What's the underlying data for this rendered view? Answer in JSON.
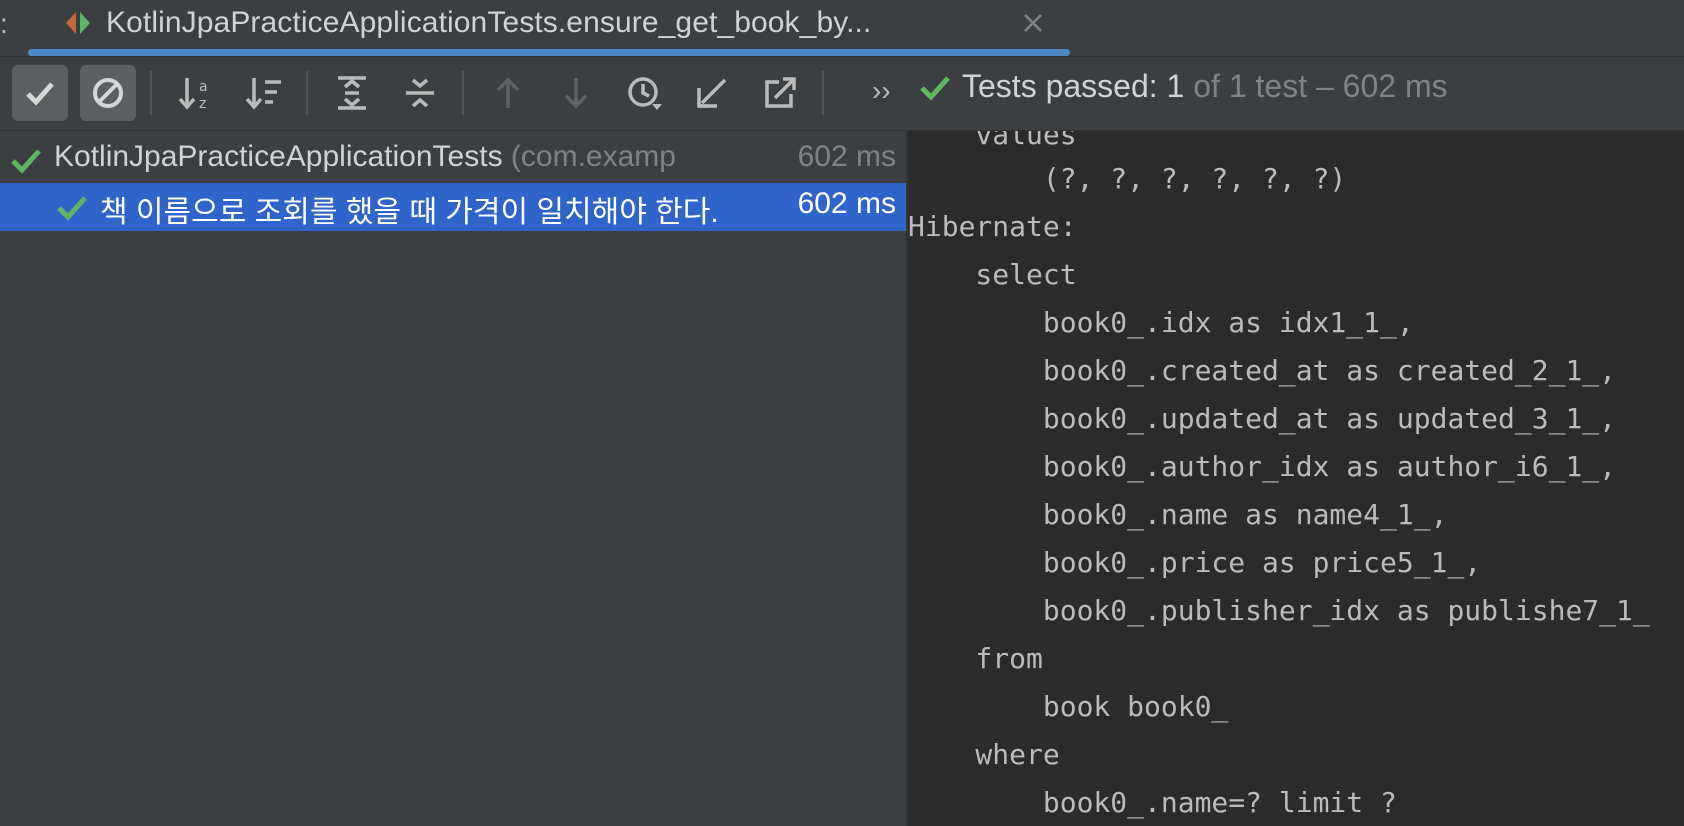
{
  "tab": {
    "prefix": ":",
    "title": "KotlinJpaPracticeApplicationTests.ensure_get_book_by...",
    "icon": "run-test-icon",
    "close_icon": "close-icon"
  },
  "toolbar": {
    "buttons": [
      {
        "name": "show-passed-button",
        "icon": "check-icon",
        "active": true
      },
      {
        "name": "show-ignored-button",
        "icon": "ignored-icon",
        "active": true
      },
      {
        "name": "sort-alphabetically-button",
        "icon": "sort-az-icon"
      },
      {
        "name": "sort-by-duration-button",
        "icon": "sort-duration-icon"
      },
      {
        "name": "expand-all-button",
        "icon": "expand-all-icon"
      },
      {
        "name": "collapse-all-button",
        "icon": "collapse-all-icon"
      },
      {
        "name": "previous-failed-button",
        "icon": "arrow-up-icon"
      },
      {
        "name": "next-failed-button",
        "icon": "arrow-down-icon"
      },
      {
        "name": "test-history-button",
        "icon": "history-icon"
      },
      {
        "name": "import-tests-button",
        "icon": "import-icon"
      },
      {
        "name": "export-tests-button",
        "icon": "export-icon"
      }
    ],
    "overflow_label": "››",
    "status": {
      "main": "Tests passed: 1",
      "muted": " of 1 test – 602 ms"
    }
  },
  "tree": {
    "root": {
      "name": "KotlinJpaPracticeApplicationTests",
      "package": " (com.examp",
      "time": "602 ms"
    },
    "child": {
      "name": "책 이름으로 조회를 했을 때 가격이 일치해야 한다.",
      "time": "602 ms"
    }
  },
  "console": {
    "lines": [
      {
        "text": "    values"
      },
      {
        "text": "        (?, ?, ?, ?, ?, ?)"
      },
      {
        "text": "Hibernate: "
      },
      {
        "text": "    select"
      },
      {
        "text": "        book0_.idx as idx1_1_,"
      },
      {
        "text": "        book0_.created_at as created_2_1_,"
      },
      {
        "text": "        book0_.updated_at as updated_3_1_,"
      },
      {
        "text": "        book0_.author_idx as author_i6_1_,"
      },
      {
        "text": "        book0_.name as name4_1_,"
      },
      {
        "text": "        book0_.price as price5_1_,"
      },
      {
        "text": "        book0_.publisher_idx as publishe7_1_"
      },
      {
        "text": "    from"
      },
      {
        "text": "        book book0_"
      },
      {
        "text": "    where"
      },
      {
        "text": "        book0_.name=? limit ?"
      }
    ]
  },
  "colors": {
    "accent": "#4a88c7",
    "selection": "#2f65ca",
    "success": "#5fb860"
  }
}
